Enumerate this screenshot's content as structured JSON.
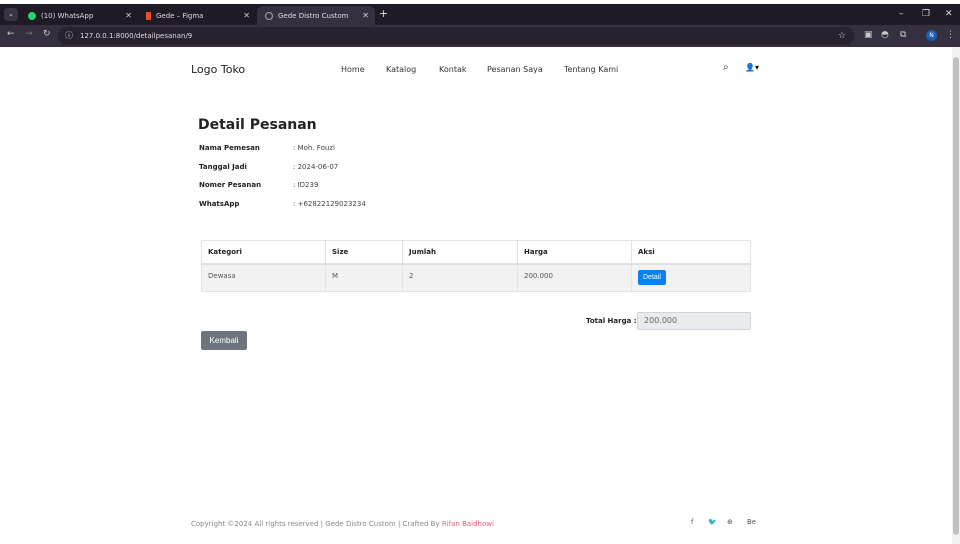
{
  "browser": {
    "tabs": [
      {
        "title": "(10) WhatsApp",
        "icon": "whatsapp-icon",
        "color": "#25d366"
      },
      {
        "title": "Gede – Figma",
        "icon": "figma-icon",
        "color": "#f24e1e"
      },
      {
        "title": "Gede Distro Custom",
        "icon": "globe-icon",
        "color": "#aaaaaa"
      }
    ],
    "url": "127.0.0.1:8000/detailpesanan/9",
    "profile_initial": "N"
  },
  "navbar": {
    "logo": "Logo Toko",
    "items": [
      "Home",
      "Katalog",
      "Kontak",
      "Pesanan Saya",
      "Tentang Kami"
    ]
  },
  "detail": {
    "title": "Detail Pesanan",
    "fields": [
      {
        "label": "Nama Pemesan",
        "value": ": Moh. Fouzi"
      },
      {
        "label": "Tanggal Jadi",
        "value": ": 2024-06-07"
      },
      {
        "label": "Nomer Pesanan",
        "value": ": ID239"
      },
      {
        "label": "WhatsApp",
        "value": ": +62822129023234"
      }
    ]
  },
  "table": {
    "headers": [
      "Kategori",
      "Size",
      "Jumlah",
      "Harga",
      "Aksi"
    ],
    "rows": [
      {
        "kategori": "Dewasa",
        "size": "M",
        "jumlah": "2",
        "harga": "200.000",
        "aksi": "Detail"
      }
    ]
  },
  "total": {
    "label": "Total Harga :",
    "value": "200.000"
  },
  "back_label": "Kembali",
  "footer": {
    "text": "Copyright ©2024 All rights reserved | Gede Distro Custom | Crafted By ",
    "author": "Rifan Baidhowi",
    "social": [
      "f",
      "t",
      "w",
      "Be"
    ]
  }
}
